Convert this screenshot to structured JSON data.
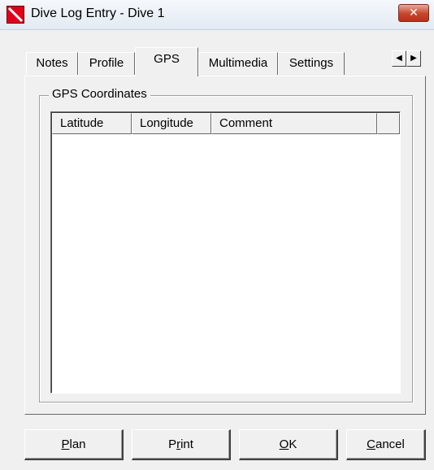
{
  "window": {
    "title": "Dive Log Entry - Dive 1",
    "close_label": "✕"
  },
  "tabs": [
    {
      "label": "Notes"
    },
    {
      "label": "Profile"
    },
    {
      "label": "GPS",
      "active": true
    },
    {
      "label": "Multimedia"
    },
    {
      "label": "Settings"
    }
  ],
  "tab_scroll": {
    "left": "◀",
    "right": "▶"
  },
  "group": {
    "title": "GPS Coordinates"
  },
  "table": {
    "columns": [
      "Latitude",
      "Longitude",
      "Comment",
      ""
    ],
    "rows": []
  },
  "buttons": {
    "plan": {
      "pre": "",
      "mnemonic": "P",
      "post": "lan"
    },
    "print": {
      "pre": "P",
      "mnemonic": "r",
      "post": "int"
    },
    "ok": {
      "pre": "",
      "mnemonic": "O",
      "post": "K"
    },
    "cancel": {
      "pre": "",
      "mnemonic": "C",
      "post": "ancel"
    }
  }
}
